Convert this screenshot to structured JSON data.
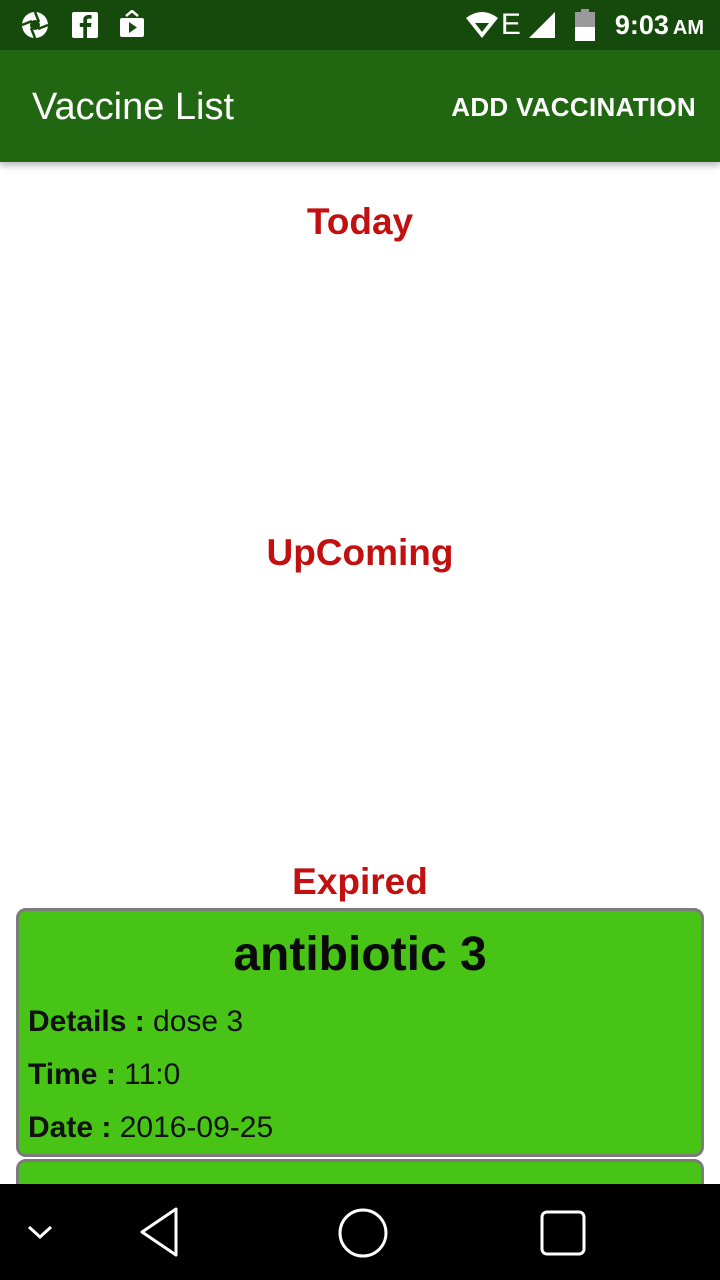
{
  "status_bar": {
    "time": "9:03",
    "ampm": "AM",
    "network_type": "E",
    "icons": [
      "aperture-icon",
      "facebook-icon",
      "media-share-icon",
      "wifi-icon",
      "signal-icon",
      "battery-icon"
    ]
  },
  "app_bar": {
    "title": "Vaccine List",
    "action": "ADD VACCINATION"
  },
  "sections": {
    "today": "Today",
    "upcoming": "UpComing",
    "expired": "Expired"
  },
  "expired_cards": [
    {
      "title": "antibiotic 3",
      "details_label": "Details :",
      "details_value": " dose 3",
      "time_label": "Time :",
      "time_value": " 11:0",
      "date_label": "Date :",
      "date_value": " 2016-09-25"
    }
  ],
  "colors": {
    "status_bar": "#164a0c",
    "app_bar": "#216611",
    "section_title": "#c20f0f",
    "card_background": "#47c415",
    "card_border": "#7b7b7b"
  },
  "nav_bar": {
    "icons": [
      "chevron-down-icon",
      "back-icon",
      "home-icon",
      "recents-icon"
    ]
  }
}
